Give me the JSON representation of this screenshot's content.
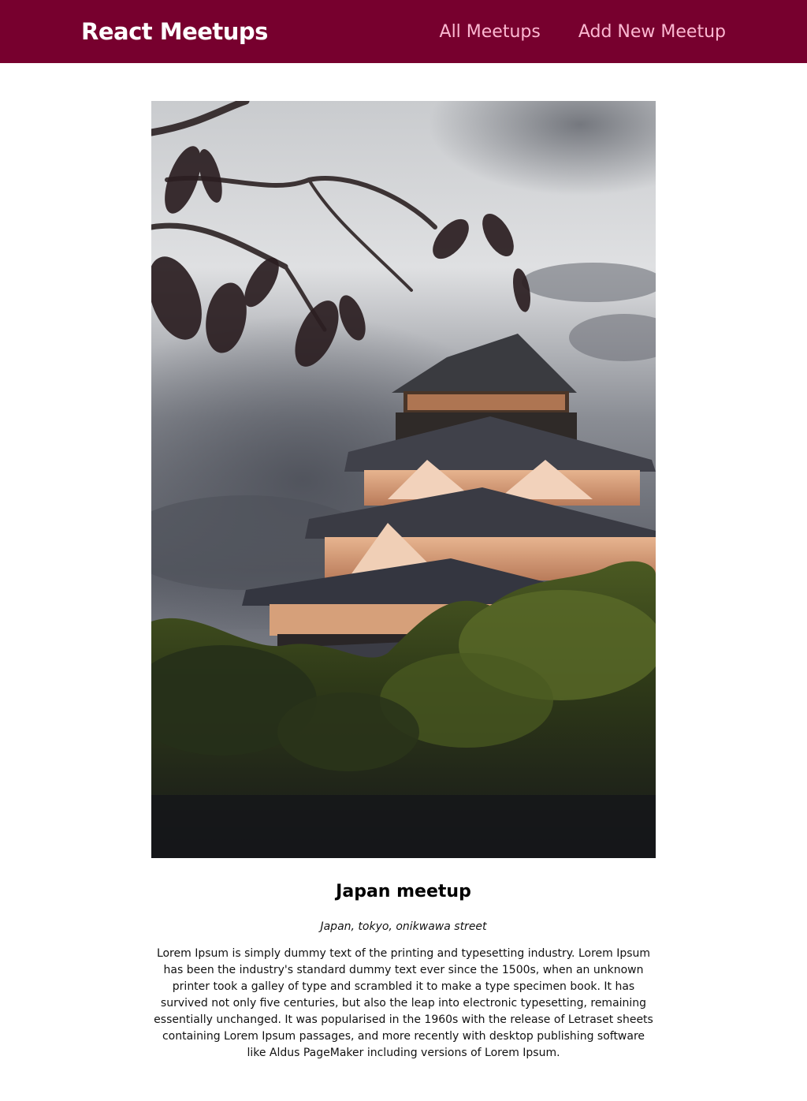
{
  "header": {
    "logo": "React Meetups",
    "nav": {
      "all_meetups": "All Meetups",
      "add_new_meetup": "Add New Meetup"
    }
  },
  "meetup": {
    "image_alt": "Japan meetup",
    "title": "Japan meetup",
    "address": "Japan, tokyo, onikwawa street",
    "description": "Lorem Ipsum is simply dummy text of the printing and typesetting industry. Lorem Ipsum has been the industry's standard dummy text ever since the 1500s, when an unknown printer took a galley of type and scrambled it to make a type specimen book. It has survived not only five centuries, but also the leap into electronic typesetting, remaining essentially unchanged. It was popularised in the 1960s with the release of Letraset sheets containing Lorem Ipsum passages, and more recently with desktop publishing software like Aldus PageMaker including versions of Lorem Ipsum."
  },
  "colors": {
    "header_bg": "#77002e",
    "logo": "#ffffff",
    "nav_link": "#fcb8d2"
  }
}
